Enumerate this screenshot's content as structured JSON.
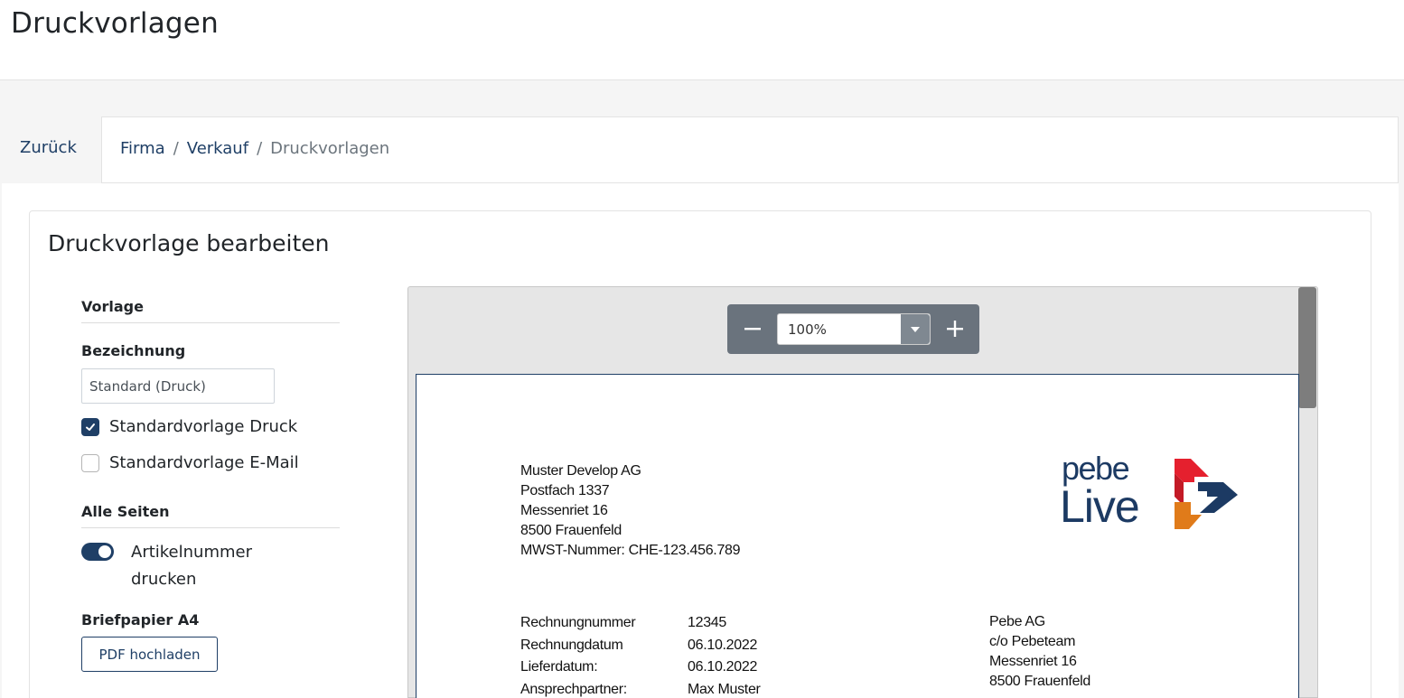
{
  "page": {
    "title": "Druckvorlagen"
  },
  "nav": {
    "back_label": "Zurück",
    "breadcrumb": [
      {
        "label": "Firma"
      },
      {
        "label": "Verkauf"
      },
      {
        "label": "Druckvorlagen"
      }
    ],
    "separator": "/"
  },
  "card": {
    "title": "Druckvorlage bearbeiten"
  },
  "form": {
    "section_vorlage": "Vorlage",
    "bezeichnung_label": "Bezeichnung",
    "bezeichnung_value": "Standard (Druck)",
    "checkbox_print": {
      "label": "Standardvorlage Druck",
      "checked": true
    },
    "checkbox_email": {
      "label": "Standardvorlage E-Mail",
      "checked": false
    },
    "section_all_pages": "Alle Seiten",
    "toggle_article": {
      "label": "Artikelnummer drucken",
      "on": true
    },
    "letterhead_label": "Briefpapier A4",
    "upload_button": "PDF hochladen"
  },
  "viewer": {
    "zoom_value": "100%",
    "zoom_minus_icon": "minus-icon",
    "zoom_plus_icon": "plus-icon",
    "document": {
      "sender": [
        "Muster Develop AG",
        "Postfach 1337",
        "Messenriet 16",
        "8500 Frauenfeld",
        "MWST-Nummer: CHE-123.456.789"
      ],
      "meta_labels": [
        "Rechnungnummer",
        "Rechnungdatum",
        "Lieferdatum:",
        "Ansprechpartner:"
      ],
      "meta_values": [
        "12345",
        "06.10.2022",
        "06.10.2022",
        "Max Muster"
      ],
      "recipient": [
        "Pebe AG",
        "c/o Pebeteam",
        "Messenriet 16",
        "8500 Frauenfeld"
      ],
      "logo": {
        "line1": "pebe",
        "line2": "Live"
      }
    }
  },
  "colors": {
    "primary": "#1f3f66",
    "logo_red": "#e5202e",
    "logo_orange": "#e07b1a",
    "logo_navy": "#1c3a63"
  }
}
